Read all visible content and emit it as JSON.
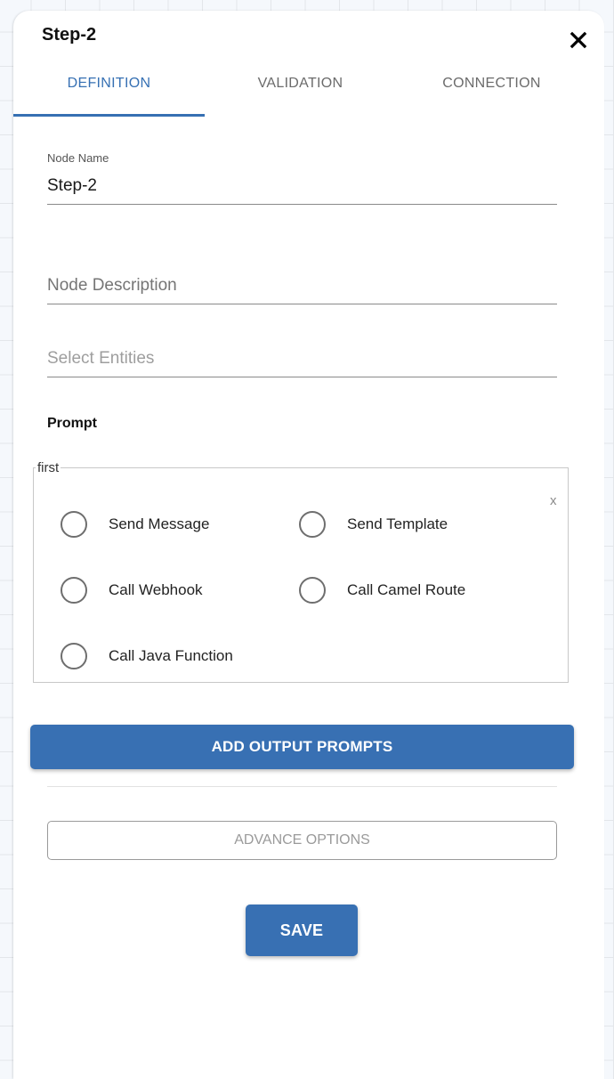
{
  "header": {
    "title": "Step-2",
    "close_icon": "close-icon"
  },
  "tabs": [
    {
      "label": "DEFINITION",
      "active": true
    },
    {
      "label": "VALIDATION",
      "active": false
    },
    {
      "label": "CONNECTION",
      "active": false
    }
  ],
  "form": {
    "node_name": {
      "label": "Node Name",
      "value": "Step-2"
    },
    "node_description": {
      "placeholder": "Node Description",
      "value": ""
    },
    "select_entities": {
      "placeholder": "Select Entities",
      "value": ""
    }
  },
  "prompt": {
    "section_title": "Prompt",
    "group": {
      "legend": "first",
      "remove_label": "x",
      "options": [
        {
          "label": "Send Message",
          "selected": false
        },
        {
          "label": "Send Template",
          "selected": false
        },
        {
          "label": "Call Webhook",
          "selected": false
        },
        {
          "label": "Call Camel Route",
          "selected": false
        },
        {
          "label": "Call Java Function",
          "selected": false
        }
      ]
    }
  },
  "actions": {
    "add_output_prompts": "ADD OUTPUT PROMPTS",
    "advance_options": "ADVANCE OPTIONS",
    "save": "SAVE"
  },
  "colors": {
    "accent": "#3670b3",
    "button": "#3870b3"
  }
}
